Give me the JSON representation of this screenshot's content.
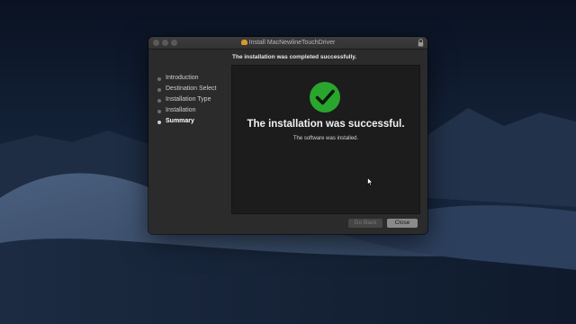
{
  "window": {
    "title": "Install MacNewlineTouchDriver",
    "header_message": "The installation was completed successfully."
  },
  "sidebar": {
    "steps": [
      {
        "label": "Introduction",
        "active": false
      },
      {
        "label": "Destination Select",
        "active": false
      },
      {
        "label": "Installation Type",
        "active": false
      },
      {
        "label": "Installation",
        "active": false
      },
      {
        "label": "Summary",
        "active": true
      }
    ]
  },
  "content": {
    "success_title": "The installation was successful.",
    "success_subtitle": "The software was installed.",
    "icon": "checkmark-circle-icon",
    "icon_color": "#2aa52e"
  },
  "buttons": {
    "back_label": "Go Back",
    "back_enabled": false,
    "close_label": "Close"
  }
}
